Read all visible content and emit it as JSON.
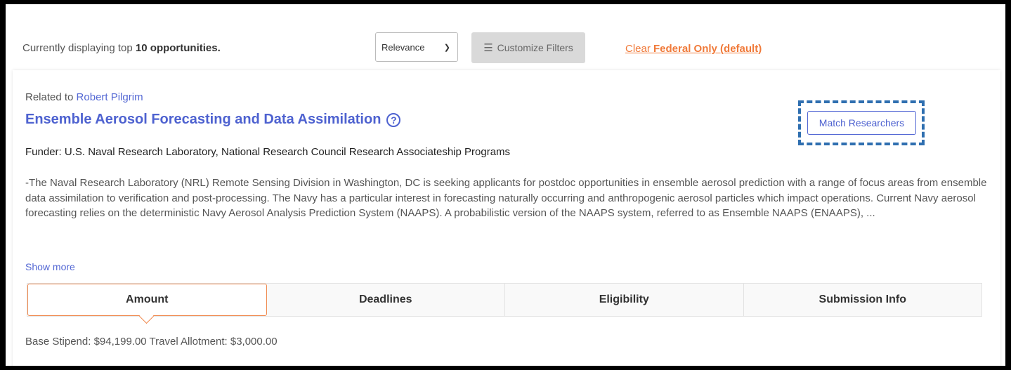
{
  "toolbar": {
    "displaying_prefix": "Currently displaying top ",
    "displaying_count": "10",
    "displaying_suffix": " opportunities.",
    "sort_selected": "Relevance",
    "filters_label": "Customize Filters",
    "clear_prefix": "Clear ",
    "clear_filter": "Federal Only (default)"
  },
  "opportunity": {
    "related_prefix": "Related to ",
    "related_name": "Robert Pilgrim",
    "title": "Ensemble Aerosol Forecasting and Data Assimilation",
    "help_symbol": "?",
    "match_button": "Match Researchers",
    "funder": "Funder: U.S. Naval Research Laboratory, National Research Council Research Associateship Programs",
    "description": "-The Naval Research Laboratory (NRL) Remote Sensing Division in Washington, DC is seeking applicants for postdoc opportunities in ensemble aerosol prediction with a range of focus areas from ensemble data assimilation to verification and post-processing. The Navy has a particular interest in forecasting naturally occurring and anthropogenic aerosol particles which impact operations. Current Navy aerosol forecasting relies on the deterministic Navy Aerosol Analysis Prediction System (NAAPS). A probabilistic version of the NAAPS system, referred to as Ensemble NAAPS (ENAAPS), ...",
    "show_more": "Show more",
    "tabs": [
      {
        "label": "Amount"
      },
      {
        "label": "Deadlines"
      },
      {
        "label": "Eligibility"
      },
      {
        "label": "Submission Info"
      }
    ],
    "active_tab": "Amount",
    "amount_text": "Base Stipend: $94,199.00 Travel Allotment: $3,000.00"
  },
  "colors": {
    "accent_blue": "#4e62d0",
    "accent_orange": "#f07a3a",
    "highlight_border": "#2f6fb0"
  },
  "icons": {
    "filters": "sliders-icon",
    "sort": "chevron-down-icon",
    "help": "question-circle-icon"
  }
}
